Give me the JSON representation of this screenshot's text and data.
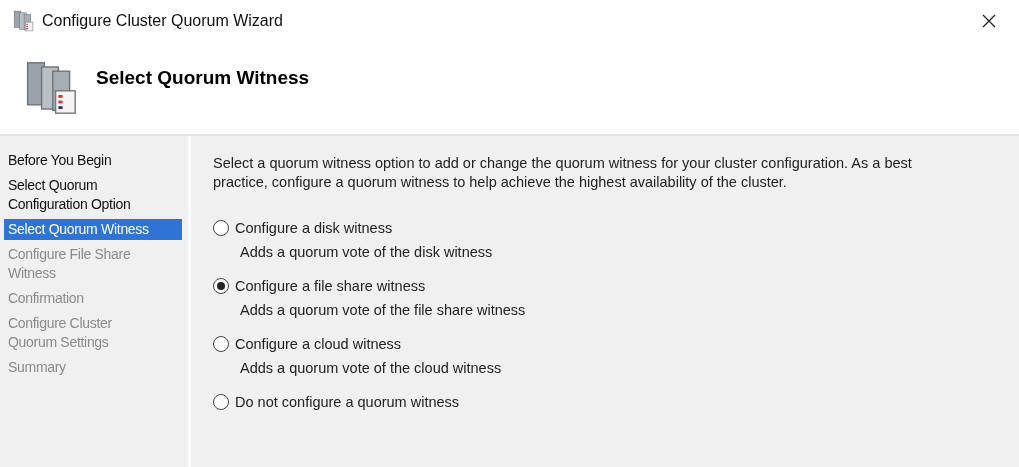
{
  "window": {
    "title": "Configure Cluster Quorum Wizard"
  },
  "header": {
    "title": "Select Quorum Witness"
  },
  "steps": [
    {
      "label": "Before You Begin",
      "selected": false,
      "disabled": false
    },
    {
      "label": "Select Quorum Configuration Option",
      "selected": false,
      "disabled": false
    },
    {
      "label": "Select Quorum Witness",
      "selected": true,
      "disabled": false
    },
    {
      "label": "Configure File Share Witness",
      "selected": false,
      "disabled": true
    },
    {
      "label": "Confirmation",
      "selected": false,
      "disabled": true
    },
    {
      "label": "Configure Cluster Quorum Settings",
      "selected": false,
      "disabled": true
    },
    {
      "label": "Summary",
      "selected": false,
      "disabled": true
    }
  ],
  "intro": "Select a quorum witness option to add or change the quorum witness for your cluster configuration. As a best practice, configure a quorum witness to help achieve the highest availability of the cluster.",
  "options": [
    {
      "label": "Configure a disk witness",
      "description": "Adds a quorum vote of the disk witness",
      "selected": false
    },
    {
      "label": "Configure a file share witness",
      "description": "Adds a quorum vote of the file share witness",
      "selected": true
    },
    {
      "label": "Configure a cloud witness",
      "description": "Adds a quorum vote of the cloud witness",
      "selected": false
    },
    {
      "label": "Do not configure a quorum witness",
      "selected": false
    }
  ]
}
